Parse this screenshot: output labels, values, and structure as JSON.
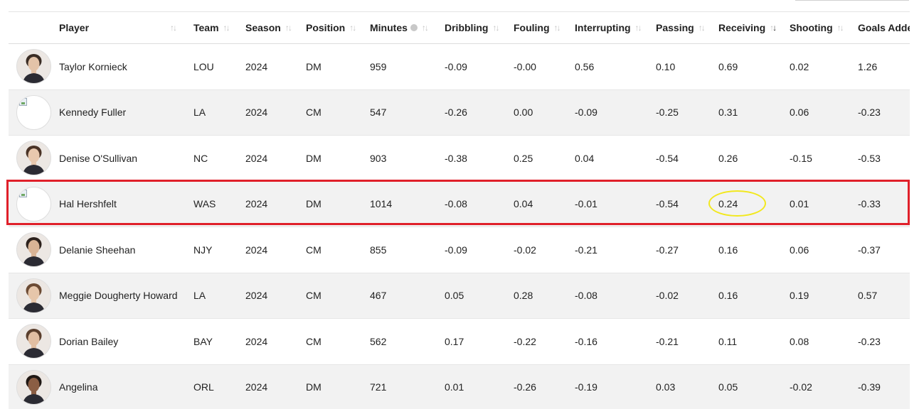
{
  "columns": {
    "player": "Player",
    "team": "Team",
    "season": "Season",
    "position": "Position",
    "minutes": "Minutes",
    "dribbling": "Dribbling",
    "fouling": "Fouling",
    "interrupting": "Interrupting",
    "passing": "Passing",
    "receiving": "Receiving",
    "shooting": "Shooting",
    "goals_added": "Goals Added"
  },
  "sort_icon": "↑↓",
  "icons": {
    "sort": "sort-arrows-icon",
    "info": "info-icon",
    "broken_image": "broken-image-icon"
  },
  "colors": {
    "highlight_box": "#e0202a",
    "highlight_circle": "#f2e81e",
    "alt_row": "#f2f2f2"
  },
  "sorted_column": "receiving",
  "rows": [
    {
      "player": "Taylor Kornieck",
      "team": "LOU",
      "season": "2024",
      "position": "DM",
      "minutes": "959",
      "dribbling": "-0.09",
      "fouling": "-0.00",
      "interrupting": "0.56",
      "passing": "0.10",
      "receiving": "0.69",
      "shooting": "0.02",
      "goals_added": "1.26",
      "avatar": "photo"
    },
    {
      "player": "Kennedy Fuller",
      "team": "LA",
      "season": "2024",
      "position": "CM",
      "minutes": "547",
      "dribbling": "-0.26",
      "fouling": "0.00",
      "interrupting": "-0.09",
      "passing": "-0.25",
      "receiving": "0.31",
      "shooting": "0.06",
      "goals_added": "-0.23",
      "avatar": "broken"
    },
    {
      "player": "Denise O'Sullivan",
      "team": "NC",
      "season": "2024",
      "position": "DM",
      "minutes": "903",
      "dribbling": "-0.38",
      "fouling": "0.25",
      "interrupting": "0.04",
      "passing": "-0.54",
      "receiving": "0.26",
      "shooting": "-0.15",
      "goals_added": "-0.53",
      "avatar": "photo"
    },
    {
      "player": "Hal Hershfelt",
      "team": "WAS",
      "season": "2024",
      "position": "DM",
      "minutes": "1014",
      "dribbling": "-0.08",
      "fouling": "0.04",
      "interrupting": "-0.01",
      "passing": "-0.54",
      "receiving": "0.24",
      "shooting": "0.01",
      "goals_added": "-0.33",
      "avatar": "broken"
    },
    {
      "player": "Delanie Sheehan",
      "team": "NJY",
      "season": "2024",
      "position": "CM",
      "minutes": "855",
      "dribbling": "-0.09",
      "fouling": "-0.02",
      "interrupting": "-0.21",
      "passing": "-0.27",
      "receiving": "0.16",
      "shooting": "0.06",
      "goals_added": "-0.37",
      "avatar": "photo"
    },
    {
      "player": "Meggie Dougherty Howard",
      "team": "LA",
      "season": "2024",
      "position": "CM",
      "minutes": "467",
      "dribbling": "0.05",
      "fouling": "0.28",
      "interrupting": "-0.08",
      "passing": "-0.02",
      "receiving": "0.16",
      "shooting": "0.19",
      "goals_added": "0.57",
      "avatar": "photo"
    },
    {
      "player": "Dorian Bailey",
      "team": "BAY",
      "season": "2024",
      "position": "CM",
      "minutes": "562",
      "dribbling": "0.17",
      "fouling": "-0.22",
      "interrupting": "-0.16",
      "passing": "-0.21",
      "receiving": "0.11",
      "shooting": "0.08",
      "goals_added": "-0.23",
      "avatar": "photo"
    },
    {
      "player": "Angelina",
      "team": "ORL",
      "season": "2024",
      "position": "DM",
      "minutes": "721",
      "dribbling": "0.01",
      "fouling": "-0.26",
      "interrupting": "-0.19",
      "passing": "0.03",
      "receiving": "0.05",
      "shooting": "-0.02",
      "goals_added": "-0.39",
      "avatar": "photo"
    }
  ]
}
